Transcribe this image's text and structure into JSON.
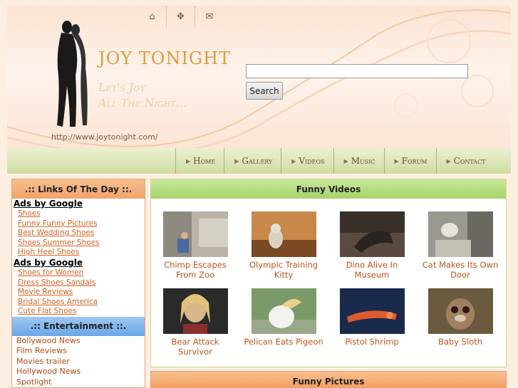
{
  "header": {
    "site_title": "JOY TONIGHT",
    "tagline_line1": "Let's Joy",
    "tagline_line2": "All The Night...",
    "url": "http://www.joytonight.com/",
    "top_icons": [
      "home-icon",
      "sitemap-icon",
      "mail-icon"
    ],
    "search": {
      "placeholder": "",
      "value": "",
      "button_label": "Search"
    },
    "nav": [
      "Home",
      "Gallery",
      "Videos",
      "Music",
      "Forum",
      "Contact"
    ]
  },
  "sidebar": {
    "links_title": ".:: Links Of The Day ::.",
    "ads_label_1": "Ads by Google",
    "ads_links_1": [
      "Shoes",
      "Funny Funny Pictures",
      "Best Wedding Shoes",
      "Shoes Summer Shoes",
      "High Heel Shoes"
    ],
    "ads_label_2": "Ads by Google",
    "ads_links_2": [
      "Shoes for Women",
      "Dress Shoes Sandals",
      "Movie Reviews",
      "Bridal Shoes America",
      "Cute Flat Shoes"
    ],
    "entertainment_title": ".:: Entertainment ::.",
    "entertainment_links": [
      "Bollywood News",
      "Film Reviews",
      "Movies trailer",
      "Hollywood News",
      "Spotlight"
    ]
  },
  "main": {
    "videos_title": "Funny Videos",
    "videos": [
      {
        "caption": "Chimp Escapes From Zoo"
      },
      {
        "caption": "Olympic Training Kitty"
      },
      {
        "caption": "Dino Alive In Museum"
      },
      {
        "caption": "Cat Makes Its Own Door"
      },
      {
        "caption": "Bear Attack Survivor"
      },
      {
        "caption": "Pelican Eats Pigeon"
      },
      {
        "caption": "Pistol Shrimp"
      },
      {
        "caption": "Baby Sloth"
      }
    ],
    "pictures_title": "Funny Pictures"
  },
  "colors": {
    "accent_orange": "#d9621f",
    "nav_green": "#cfdca0",
    "title_gold": "#e19b38"
  }
}
